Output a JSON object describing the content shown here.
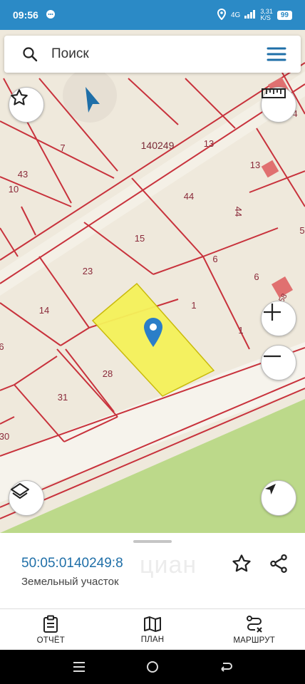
{
  "status": {
    "time": "09:56",
    "network": "4G",
    "speed": "3,31",
    "speed_unit": "K/S",
    "battery": "99"
  },
  "search": {
    "placeholder": "Поиск"
  },
  "map": {
    "block_label": "140249",
    "parcel_numbers": [
      "7",
      "43",
      "10",
      "13",
      "13",
      "44",
      "44",
      "15",
      "6",
      "5",
      "23",
      "6",
      "14",
      "1",
      "1",
      "6",
      "28",
      "31",
      "30",
      "4",
      "58"
    ]
  },
  "sheet": {
    "parcel_id": "50:05:0140249:8",
    "parcel_type": "Земельный участок",
    "watermark": "циан"
  },
  "nav": {
    "report": "ОТЧЁТ",
    "plan": "ПЛАН",
    "route": "МАРШРУТ"
  },
  "colors": {
    "accent": "#1f6fa8",
    "status_bar": "#2b8ac6",
    "boundary": "#c8323c",
    "selected_parcel": "#f5f25a",
    "pin": "#2a7ec8"
  }
}
